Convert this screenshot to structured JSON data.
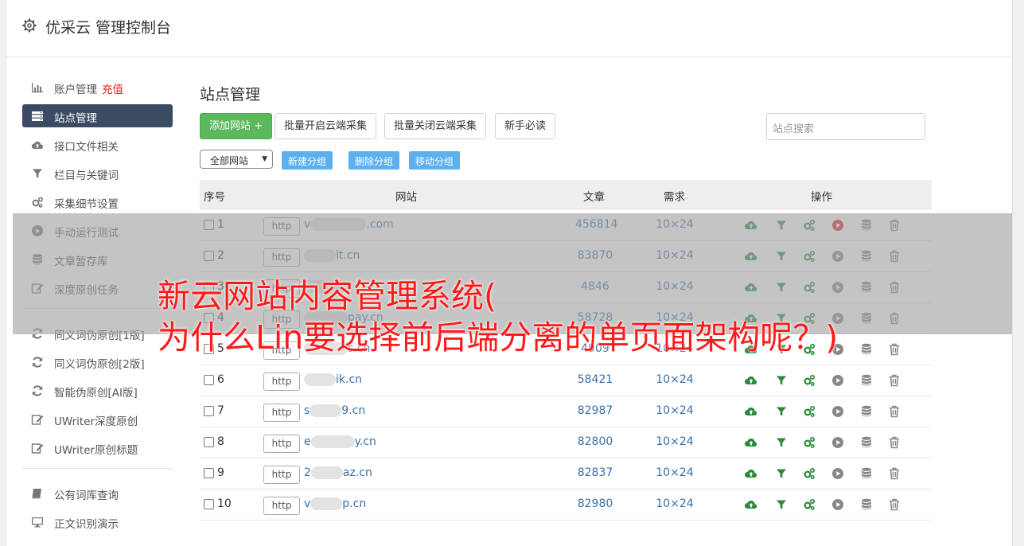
{
  "header": {
    "title": "优采云 管理控制台"
  },
  "sidebar": {
    "items": [
      {
        "label": "账户管理",
        "badge": "充值",
        "icon": "bar-chart-icon"
      },
      {
        "label": "站点管理",
        "icon": "server-icon",
        "active": true
      },
      {
        "label": "接口文件相关",
        "icon": "cloud-upload-icon"
      },
      {
        "label": "栏目与关键词",
        "icon": "filter-icon"
      },
      {
        "label": "采集细节设置",
        "icon": "gears-icon"
      },
      {
        "label": "手动运行测试",
        "icon": "play-icon"
      },
      {
        "label": "文章暂存库",
        "icon": "database-icon"
      },
      {
        "label": "深度原创任务",
        "icon": "edit-icon"
      },
      {
        "label": "同义词伪原创[1版]",
        "icon": "refresh-icon"
      },
      {
        "label": "同义词伪原创[2版]",
        "icon": "refresh-icon"
      },
      {
        "label": "智能伪原创[AI版]",
        "icon": "refresh-icon"
      },
      {
        "label": "UWriter深度原创",
        "icon": "edit-icon"
      },
      {
        "label": "UWriter原创标题",
        "icon": "edit-icon"
      },
      {
        "label": "公有词库查询",
        "icon": "book-icon"
      },
      {
        "label": "正文识别演示",
        "icon": "monitor-icon"
      }
    ]
  },
  "main": {
    "title": "站点管理",
    "toolbar": {
      "add_label": "添加网站 +",
      "batch_on_label": "批量开启云端采集",
      "batch_off_label": "批量关闭云端采集",
      "guide_label": "新手必读",
      "search_placeholder": "站点搜索"
    },
    "filter": {
      "group_select": "全部网站",
      "new_group": "新建分组",
      "delete_group": "删除分组",
      "move_group": "移动分组"
    },
    "table": {
      "headers": {
        "index": "序号",
        "site": "网站",
        "articles": "文章",
        "demand": "需求",
        "ops": "操作"
      },
      "protocol_label": "http",
      "rows": [
        {
          "num": "1",
          "prefix": "v",
          "suffix": ".com",
          "articles": "456814",
          "demand": "10×24",
          "running": true
        },
        {
          "num": "2",
          "prefix": "",
          "suffix": "lt.cn",
          "articles": "83870",
          "demand": "10×24",
          "running": false
        },
        {
          "num": "3",
          "prefix": "",
          "suffix": "",
          "articles": "4846",
          "demand": "10×24",
          "running": false
        },
        {
          "num": "4",
          "prefix": "",
          "suffix": "pay.cn",
          "articles": "58728",
          "demand": "10×24",
          "running": false
        },
        {
          "num": "5",
          "prefix": "",
          "suffix": "s.cn",
          "articles": "4909",
          "demand": "10×24",
          "running": false
        },
        {
          "num": "6",
          "prefix": "",
          "suffix": "ik.cn",
          "articles": "58421",
          "demand": "10×24",
          "running": false
        },
        {
          "num": "7",
          "prefix": "s",
          "suffix": "9.cn",
          "articles": "82987",
          "demand": "10×24",
          "running": false
        },
        {
          "num": "8",
          "prefix": "e",
          "suffix": "y.cn",
          "articles": "82800",
          "demand": "10×24",
          "running": false
        },
        {
          "num": "9",
          "prefix": "2",
          "suffix": "az.cn",
          "articles": "82837",
          "demand": "10×24",
          "running": false
        },
        {
          "num": "10",
          "prefix": "v",
          "suffix": "p.cn",
          "articles": "82980",
          "demand": "10×24",
          "running": false
        }
      ]
    }
  },
  "overlay": {
    "line1": "新云网站内容管理系统(",
    "line2": "为什么Lin要选择前后端分离的单页面架构呢？)"
  },
  "colors": {
    "accent_green": "#5cb85c",
    "sidebar_active": "#3c4b64",
    "link_blue": "#3a6fa8",
    "small_button_blue": "#5bb0f0",
    "caption_red": "#ff1a1a",
    "badge_red": "#e02020"
  }
}
